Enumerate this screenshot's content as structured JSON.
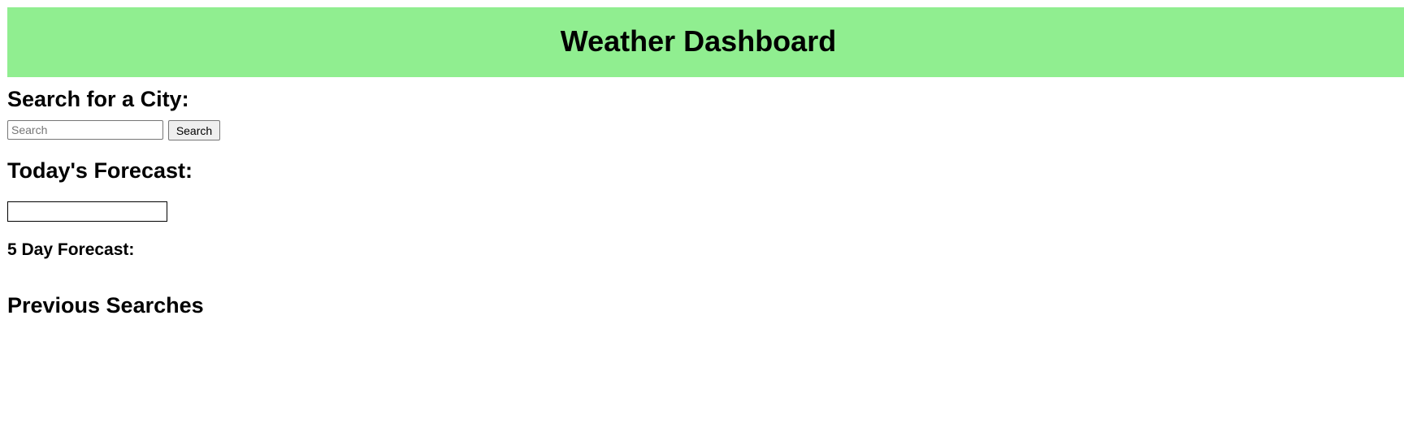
{
  "header": {
    "title": "Weather Dashboard",
    "background_color": "#90ee90"
  },
  "search": {
    "heading": "Search for a City:",
    "input_value": "",
    "placeholder": "Search",
    "button_label": "Search"
  },
  "today": {
    "heading": "Today's Forecast:",
    "content": ""
  },
  "five_day": {
    "heading": "5 Day Forecast:"
  },
  "previous": {
    "heading": "Previous Searches",
    "items": []
  }
}
